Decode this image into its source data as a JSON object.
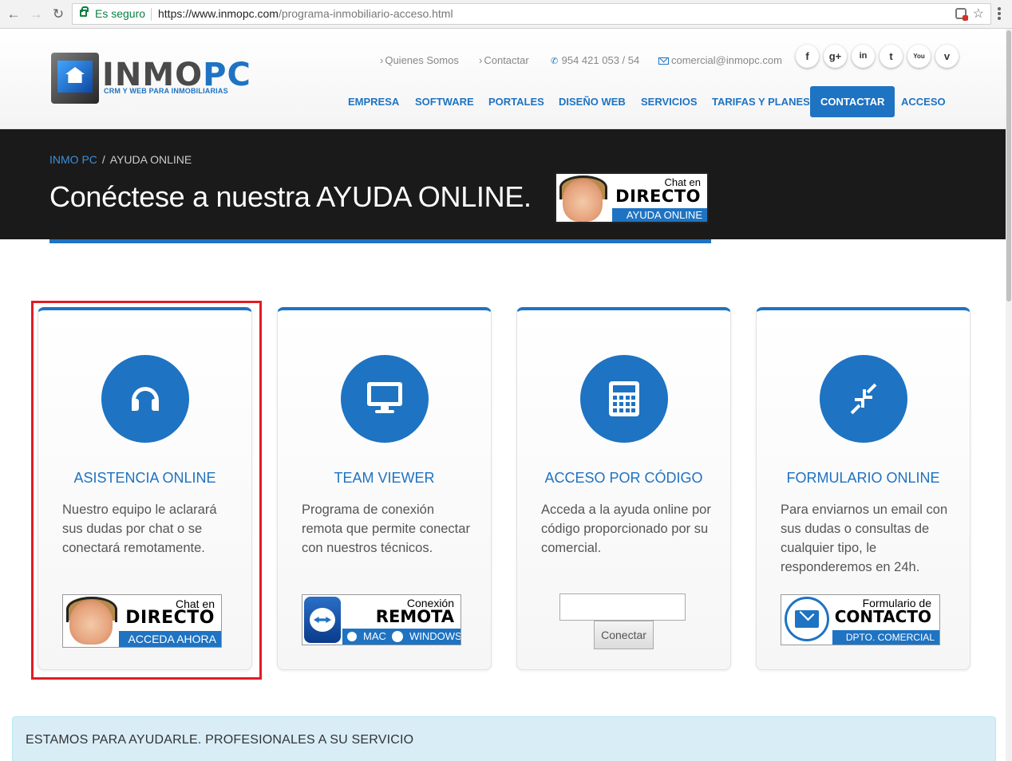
{
  "browser": {
    "secure_label": "Es seguro",
    "url_host": "https://www.inmopc.com",
    "url_path": "/programa-inmobiliario-acceso.html"
  },
  "brand": {
    "name_a": "INMO",
    "name_b": "PC",
    "tagline": "CRM Y WEB PARA INMOBILIARIAS"
  },
  "toplinks": {
    "quienes": "Quienes Somos",
    "contactar": "Contactar",
    "phone": "954 421 053 / 54",
    "email": "comercial@inmopc.com"
  },
  "social": [
    {
      "icon": "facebook-icon",
      "glyph": "f"
    },
    {
      "icon": "google-plus-icon",
      "glyph": "g+"
    },
    {
      "icon": "linkedin-icon",
      "glyph": "in"
    },
    {
      "icon": "twitter-icon",
      "glyph": "t"
    },
    {
      "icon": "youtube-icon",
      "glyph": "You"
    },
    {
      "icon": "vimeo-icon",
      "glyph": "v"
    }
  ],
  "nav": [
    "EMPRESA",
    "SOFTWARE",
    "PORTALES",
    "DISEÑO WEB",
    "SERVICIOS",
    "TARIFAS Y PLANES",
    "CONTACTAR",
    "ACCESO"
  ],
  "nav_active": "CONTACTAR",
  "breadcrumb": {
    "home": "INMO PC",
    "sep": "/",
    "current": "AYUDA ONLINE"
  },
  "banner": {
    "title": "Conéctese a nuestra AYUDA ONLINE.",
    "badge_small": "Chat en",
    "badge_big": "DIRECTO",
    "badge_strip": "AYUDA ONLINE"
  },
  "cards": [
    {
      "title": "ASISTENCIA ONLINE",
      "text": "Nuestro equipo le aclarará sus dudas por chat o se conectará remotamente.",
      "btn_small": "Chat en",
      "btn_big": "DIRECTO",
      "btn_strip": "ACCEDA AHORA"
    },
    {
      "title": "TEAM VIEWER",
      "text": "Programa de conexión remota que permite conectar con nuestros técnicos.",
      "btn_small": "Conexión",
      "btn_big": "REMOTA",
      "btn_strip_a": "MAC",
      "btn_strip_b": "WINDOWS"
    },
    {
      "title": "ACCESO POR CÓDIGO",
      "text": "Acceda a la ayuda online por código proporcionado por su comercial.",
      "input_value": "",
      "button": "Conectar"
    },
    {
      "title": "FORMULARIO ONLINE",
      "text": "Para enviarnos un email con sus dudas o consultas de cualquier tipo, le responderemos en 24h.",
      "btn_small": "Formulario de",
      "btn_big": "CONTACTO",
      "btn_strip": "DPTO. COMERCIAL"
    }
  ],
  "infobar": "ESTAMOS PARA AYUDARLE. PROFESIONALES A SU SERVICIO",
  "colors": {
    "accent": "#1e73c2",
    "banner_bg": "#1a1a1a",
    "highlight": "#e01c24",
    "info_bg": "#d9edf7"
  }
}
